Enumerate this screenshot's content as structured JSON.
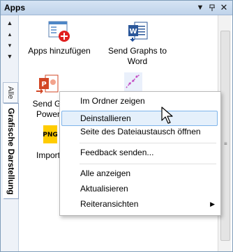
{
  "panel": {
    "title": "Apps",
    "dropdown_icon": "triangle-down-icon",
    "pin_icon": "pin-icon",
    "close_icon": "close-icon"
  },
  "sidebar": {
    "tabs": [
      {
        "label": "Alle"
      },
      {
        "label": "Grafische Darstellung"
      }
    ]
  },
  "apps": [
    {
      "label_line1": "Apps hinzufügen",
      "label_line2": "",
      "icon": "apps-add-icon"
    },
    {
      "label_line1": "Send Graphs to",
      "label_line2": "Word",
      "icon": "word-icon"
    },
    {
      "label_line1": "Send Gr",
      "label_line2": "Power",
      "icon": "powerpoint-icon"
    },
    {
      "label_line1": "Import",
      "label_line2": "",
      "icon": "png-icon"
    }
  ],
  "context_menu": {
    "items": [
      {
        "label": "Im Ordner zeigen"
      },
      {
        "label": "Deinstallieren",
        "highlighted": true
      },
      {
        "label": "Seite des Dateiaustausch öffnen"
      },
      {
        "label": "Feedback senden..."
      },
      {
        "label": "Alle anzeigen"
      },
      {
        "label": "Aktualisieren"
      },
      {
        "label": "Reiteransichten",
        "has_submenu": true
      }
    ]
  },
  "colors": {
    "titlebar": "#c9dbef",
    "highlight": "#e5f0fb",
    "highlight_border": "#7eb4ea",
    "word_blue": "#2b579a",
    "ppt_orange": "#d24726",
    "add_red": "#e02020"
  }
}
